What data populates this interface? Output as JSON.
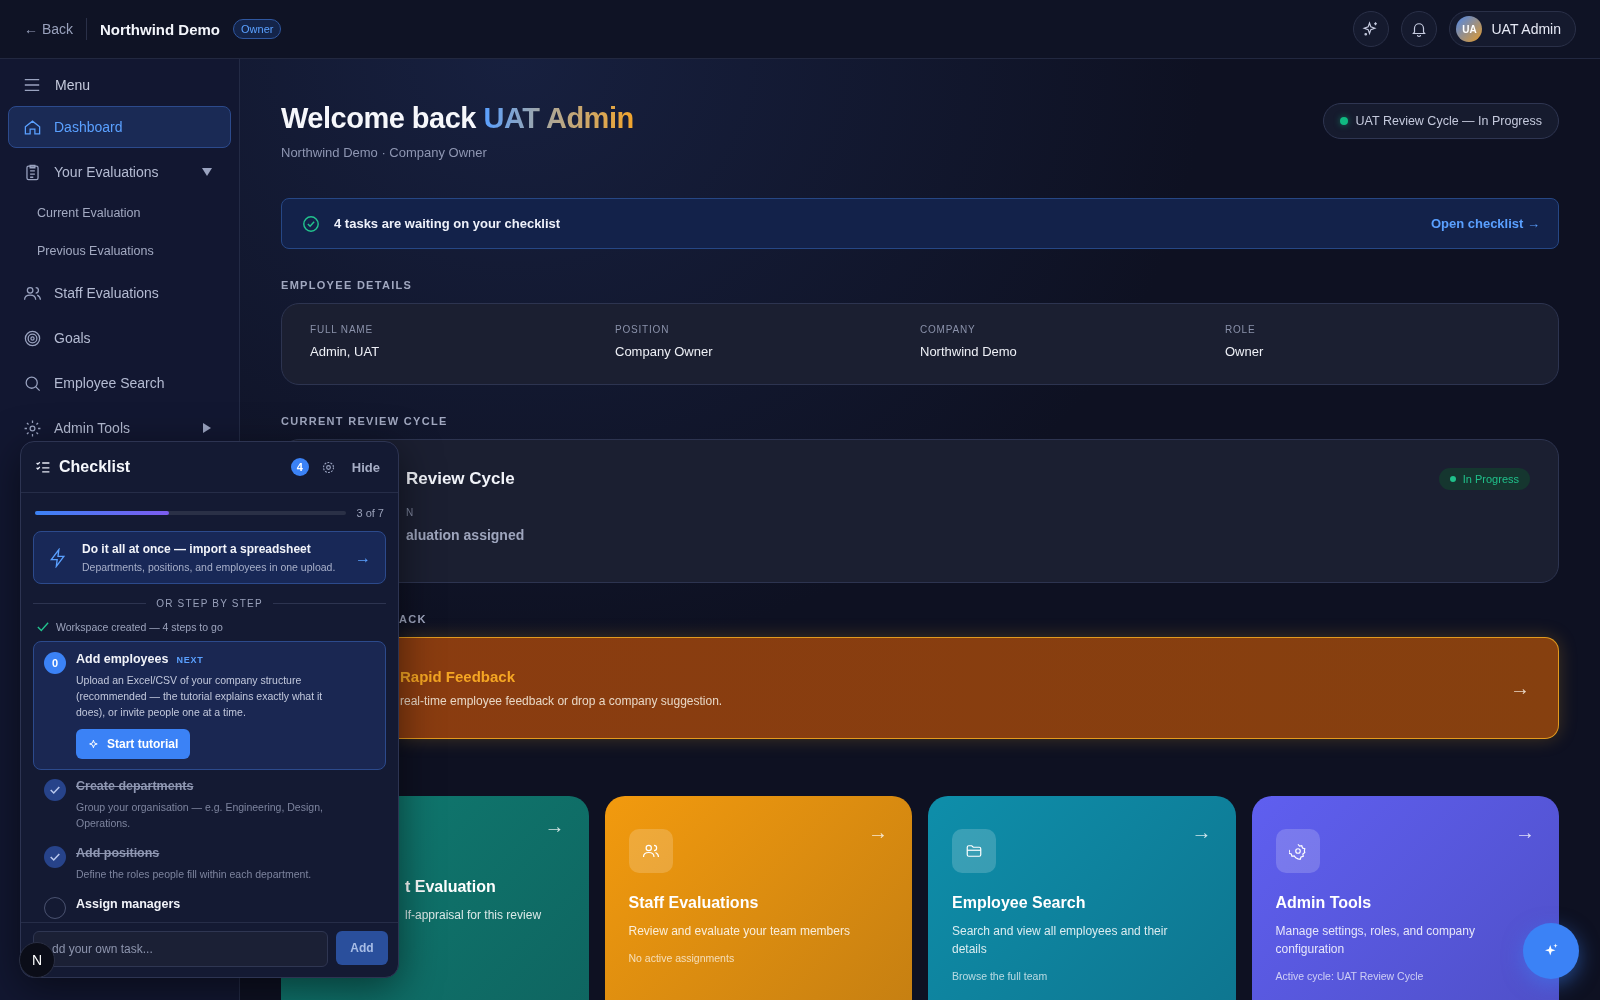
{
  "topbar": {
    "back": "← Back",
    "title": "Northwind Demo",
    "badge": "Owner",
    "user": {
      "initials": "UA",
      "name": "UAT Admin"
    }
  },
  "sidebar": {
    "menu": "Menu",
    "items": [
      {
        "label": "Dashboard",
        "selected": true
      },
      {
        "label": "Your Evaluations",
        "selected": false,
        "expanded": true,
        "children": [
          {
            "label": "Current Evaluation",
            "selected": false
          },
          {
            "label": "Previous Evaluations",
            "selected": false
          }
        ]
      },
      {
        "label": "Staff Evaluations",
        "selected": false
      },
      {
        "label": "Goals",
        "selected": false
      },
      {
        "label": "Employee Search",
        "selected": false
      },
      {
        "label": "Admin Tools",
        "selected": false,
        "expanded": false
      }
    ]
  },
  "header": {
    "greeting": "Welcome back",
    "name": "UAT Admin",
    "subtitle": "Northwind Demo · Company Owner",
    "status": "UAT Review Cycle — In Progress"
  },
  "banner": {
    "text": "4 tasks are waiting on your checklist",
    "link": "Open checklist →"
  },
  "employee_details": {
    "heading": "EMPLOYEE DETAILS",
    "fields": [
      {
        "label": "FULL NAME",
        "value": "Admin, UAT"
      },
      {
        "label": "POSITION",
        "value": "Company Owner"
      },
      {
        "label": "COMPANY",
        "value": "Northwind Demo"
      },
      {
        "label": "ROLE",
        "value": "Owner"
      }
    ]
  },
  "review_cycle": {
    "heading": "CURRENT REVIEW CYCLE",
    "title": "Review Cycle",
    "status": "In Progress",
    "field_label": "N",
    "field_value": "aluation assigned"
  },
  "feedback": {
    "heading": "ACK",
    "title": "Rapid Feedback",
    "description": "real-time employee feedback or drop a company suggestion.",
    "arrow": "→"
  },
  "quick_cards": [
    {
      "title": "t Evaluation",
      "description": "lf-appraisal for this review",
      "arrow": "→",
      "color": "#0f7a70",
      "covered": true
    },
    {
      "title": "Staff Evaluations",
      "description": "Review and evaluate your team members",
      "footer": "No active assignments",
      "arrow": "→",
      "color": "#f29a0e",
      "covered": false
    },
    {
      "title": "Employee Search",
      "description": "Search and view all employees and their details",
      "footer": "Browse the full team",
      "arrow": "→",
      "color": "#0e8eaa",
      "covered": false
    },
    {
      "title": "Admin Tools",
      "description": "Manage settings, roles, and company configuration",
      "footer": "Active cycle: UAT Review Cycle",
      "arrow": "→",
      "color": "#5f5ff0",
      "covered": false
    }
  ],
  "checklist": {
    "title": "Checklist",
    "count": "4",
    "hide": "Hide",
    "progress": {
      "level": 0.43,
      "reading": "3 of 7"
    },
    "import": {
      "title": "Do it all at once — import a spreadsheet",
      "description": "Departments, positions, and employees in one upload.",
      "arrow": "→"
    },
    "divider": "OR STEP BY STEP",
    "workspace": "Workspace created — 4 steps to go",
    "steps": [
      {
        "kind": "current",
        "number": "0",
        "title": "Add employees",
        "tag": "NEXT",
        "description": "Upload an Excel/CSV of your company structure (recommended — the tutorial explains exactly what it does), or invite people one at a time.",
        "button": "Start tutorial"
      },
      {
        "kind": "done",
        "title": "Create departments",
        "description": "Group your organisation — e.g. Engineering, Design, Operations."
      },
      {
        "kind": "done",
        "title": "Add positions",
        "description": "Define the roles people fill within each department."
      },
      {
        "kind": "pending",
        "title": "Assign managers"
      }
    ],
    "input": {
      "placeholder": "dd your own task..."
    },
    "add": "Add"
  },
  "dev_badge": "N"
}
